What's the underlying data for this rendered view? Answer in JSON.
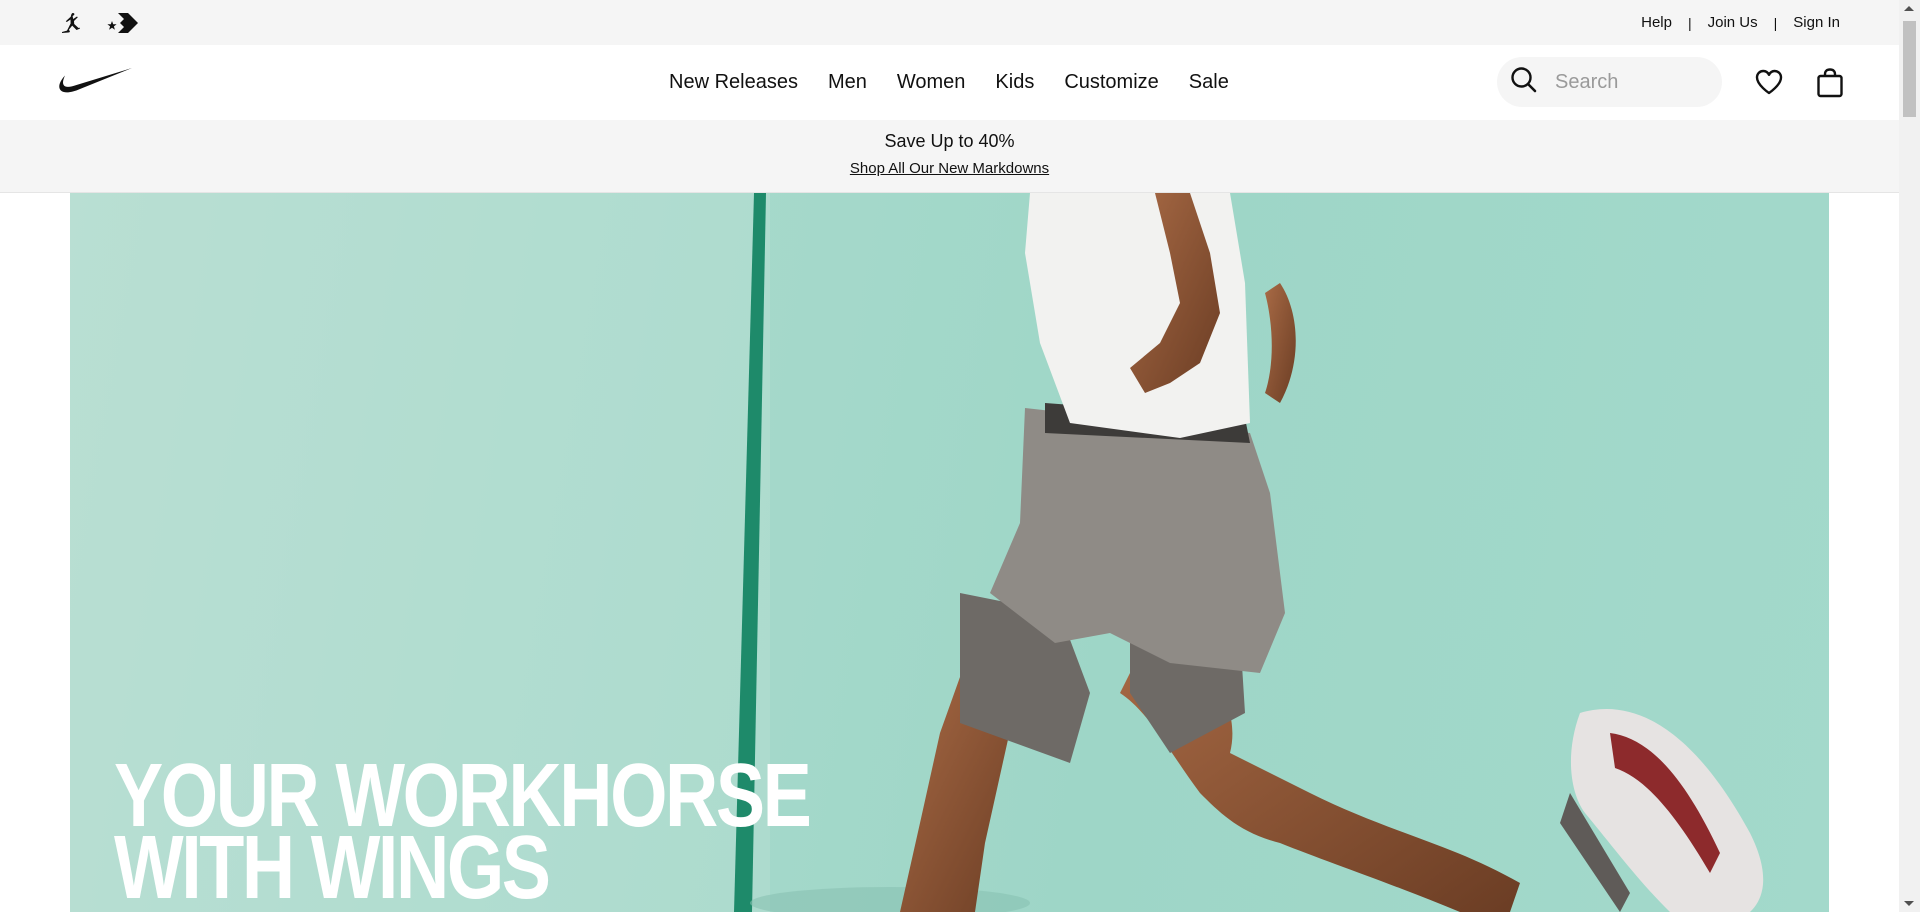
{
  "utility": {
    "brand_icons": [
      "jordan-jumpman-icon",
      "converse-star-chevron-icon"
    ],
    "links": [
      {
        "label": "Help"
      },
      {
        "label": "Join Us"
      },
      {
        "label": "Sign In"
      }
    ],
    "separator": "|"
  },
  "nav": {
    "logo": "nike-swoosh-logo",
    "links": [
      {
        "label": "New Releases"
      },
      {
        "label": "Men"
      },
      {
        "label": "Women"
      },
      {
        "label": "Kids"
      },
      {
        "label": "Customize"
      },
      {
        "label": "Sale"
      }
    ],
    "search": {
      "placeholder": "Search",
      "value": "",
      "icon": "search-icon"
    },
    "favorites_icon": "heart-icon",
    "bag_icon": "bag-icon"
  },
  "promo": {
    "headline": "Save Up to 40%",
    "link": "Shop All Our New Markdowns"
  },
  "hero": {
    "title_line1": "YOUR WORKHORSE",
    "title_line2": "WITH WINGS",
    "background_color": "#a3d9cb"
  },
  "colors": {
    "utility_bg": "#f5f5f5",
    "text": "#111111",
    "hero_teal": "#a3d9cb"
  }
}
